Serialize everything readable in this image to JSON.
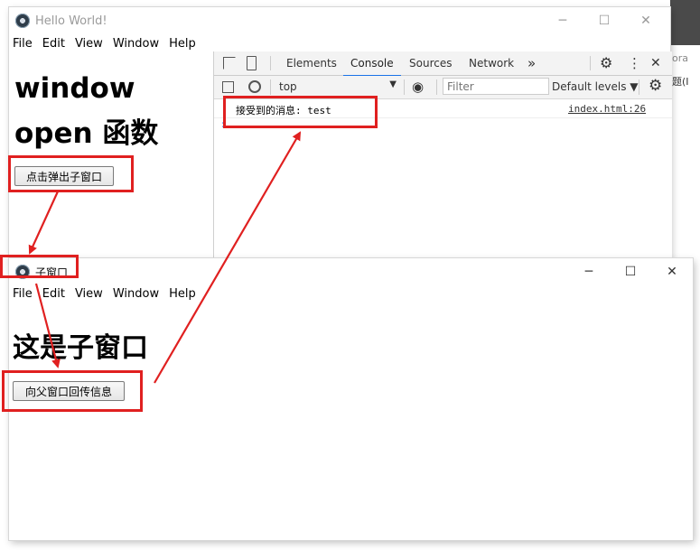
{
  "main_window": {
    "title": "Hello World!",
    "menu": [
      "File",
      "Edit",
      "View",
      "Window",
      "Help"
    ],
    "heading_line1": "window",
    "heading_line2": "open 函数",
    "open_button": "点击弹出子窗口",
    "controls": {
      "minimize": "─",
      "maximize": "☐",
      "close": "✕"
    }
  },
  "devtools": {
    "tabs": [
      "Elements",
      "Console",
      "Sources",
      "Network"
    ],
    "active_tab": "Console",
    "more_tabs": "»",
    "context": "top",
    "filter_placeholder": "Filter",
    "levels": "Default levels ▼",
    "log_message": "接受到的消息: test",
    "log_source": "index.html:26",
    "prompt": "›"
  },
  "background_window_text": {
    "line1": "ora",
    "line2": "题(I"
  },
  "child_window": {
    "title": "子窗口",
    "menu": [
      "File",
      "Edit",
      "View",
      "Window",
      "Help"
    ],
    "heading": "这是子窗口",
    "reply_button": "向父窗口回传信息",
    "controls": {
      "minimize": "─",
      "maximize": "☐",
      "close": "✕"
    }
  },
  "colors": {
    "annotation_red": "#e02020",
    "devtools_accent": "#1a73e8"
  }
}
